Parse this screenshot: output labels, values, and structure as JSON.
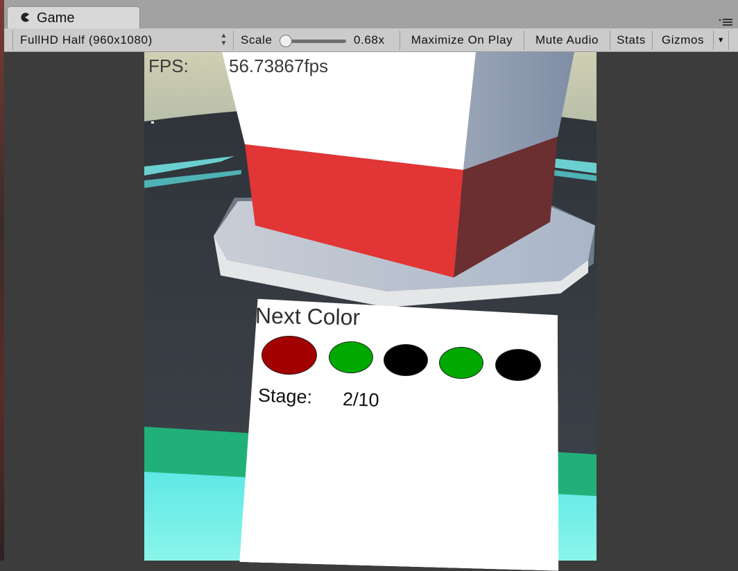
{
  "window": {
    "tab_label": "Game",
    "tab_icon": "pacman-icon"
  },
  "toolbar": {
    "resolution": "FullHD Half (960x1080)",
    "scale_label": "Scale",
    "scale_value": "0.68x",
    "maximize_label": "Maximize On Play",
    "mute_label": "Mute Audio",
    "stats_label": "Stats",
    "gizmos_label": "Gizmos"
  },
  "game": {
    "fps_label": "FPS:",
    "fps_value": "56.73867fps",
    "next_color_label": "Next Color",
    "next_colors": [
      "#a30000",
      "#00a800",
      "#000000",
      "#00a800",
      "#000000"
    ],
    "stage_label": "Stage:",
    "stage_value": "2/10"
  },
  "colors": {
    "cube_red": "#e23535",
    "cube_red_side": "#6b2e31",
    "cube_white": "#ffffff",
    "ring_cyan": "#6ccfcf",
    "floor_green": "#21b07a"
  }
}
